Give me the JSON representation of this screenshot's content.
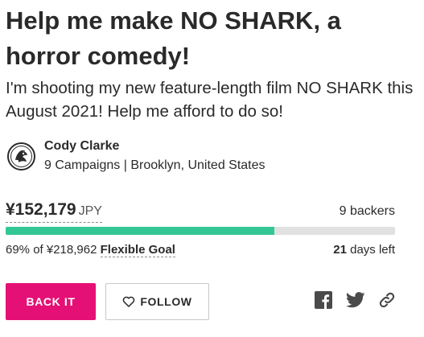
{
  "campaign": {
    "title": "Help me make NO SHARK, a horror comedy!",
    "subtitle": "I'm shooting my new feature-length film NO SHARK this August 2021! Help me afford to do so!"
  },
  "owner": {
    "name": "Cody Clarke",
    "meta": "9 Campaigns | Brooklyn, United States",
    "avatar_icon": "owner-avatar-icon"
  },
  "funding": {
    "raised": "¥152,179",
    "currency": "JPY",
    "backers_count": "9",
    "backers_label": "backers",
    "percent_text": "69% of ¥218,962",
    "goal_type": "Flexible Goal",
    "progress_fraction": 0.69,
    "days_left_num": "21",
    "days_left_label": "days left",
    "progress_color": "#34c796"
  },
  "actions": {
    "back_label": "BACK IT",
    "follow_label": "FOLLOW",
    "follow_icon": "heart-outline-icon",
    "back_color": "#e51075"
  },
  "share": {
    "icons": [
      "facebook-icon",
      "twitter-icon",
      "link-icon"
    ],
    "icon_color": "#4a4a4a"
  }
}
